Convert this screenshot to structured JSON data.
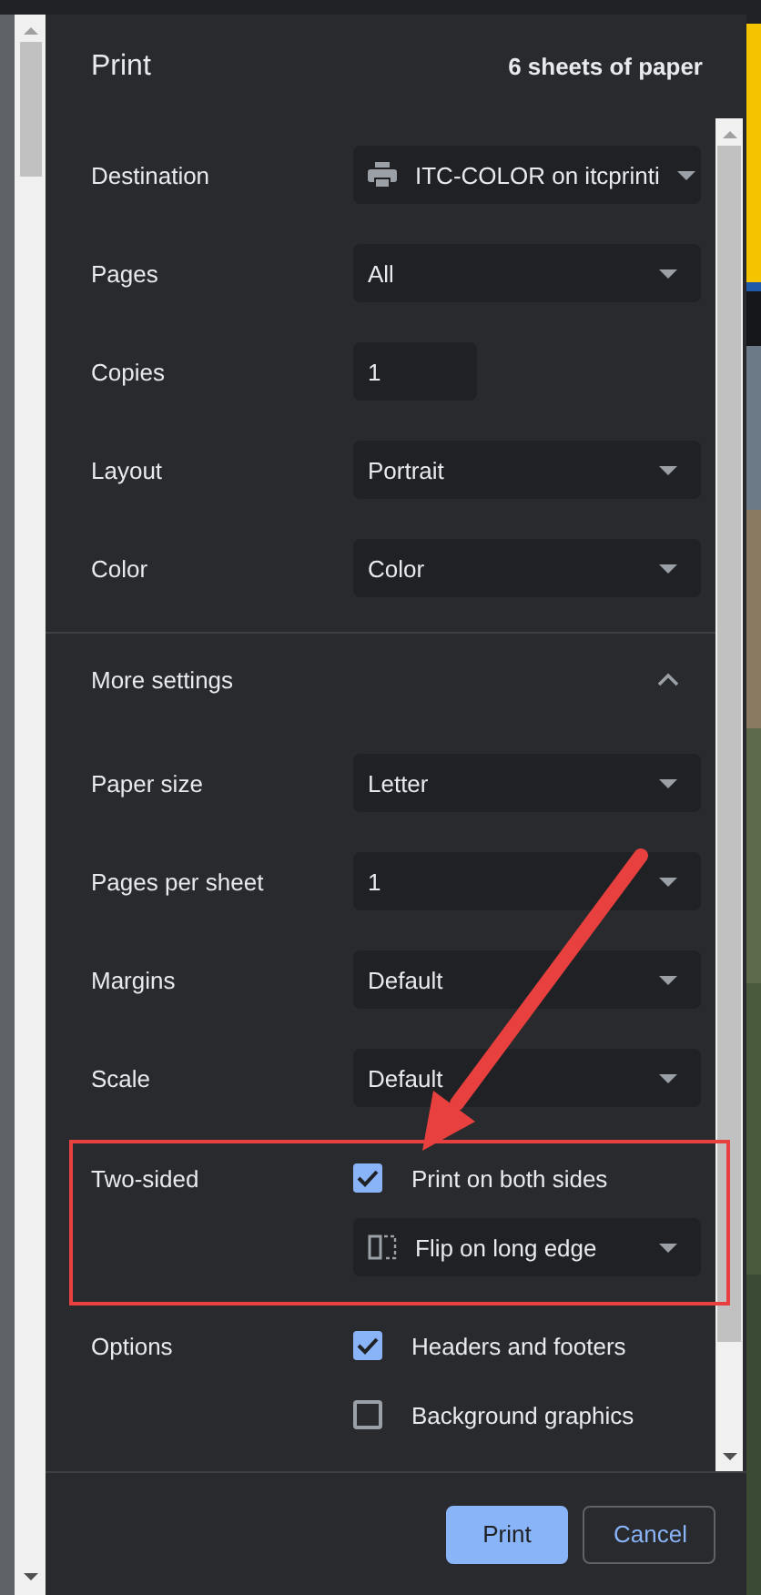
{
  "header": {
    "title": "Print",
    "summary": "6 sheets of paper"
  },
  "settings": [
    {
      "kind": "destination",
      "label": "Destination",
      "value": "ITC-COLOR on itcprinti"
    },
    {
      "kind": "select",
      "label": "Pages",
      "value": "All"
    },
    {
      "kind": "number",
      "label": "Copies",
      "value": "1"
    },
    {
      "kind": "select",
      "label": "Layout",
      "value": "Portrait"
    },
    {
      "kind": "select",
      "label": "Color",
      "value": "Color"
    },
    {
      "kind": "section",
      "label": "More settings",
      "expanded": true
    },
    {
      "kind": "select",
      "label": "Paper size",
      "value": "Letter"
    },
    {
      "kind": "select",
      "label": "Pages per sheet",
      "value": "1"
    },
    {
      "kind": "select",
      "label": "Margins",
      "value": "Default"
    },
    {
      "kind": "select",
      "label": "Scale",
      "value": "Default"
    },
    {
      "kind": "two-sided",
      "label": "Two-sided",
      "checkbox": {
        "label": "Print on both sides",
        "checked": true
      },
      "flip": "Flip on long edge"
    },
    {
      "kind": "options",
      "label": "Options",
      "items": [
        {
          "label": "Headers and footers",
          "checked": true
        },
        {
          "label": "Background graphics",
          "checked": false
        }
      ]
    }
  ],
  "buttons": [
    {
      "label": "Print",
      "kind": "primary"
    },
    {
      "label": "Cancel",
      "kind": "secondary"
    }
  ]
}
